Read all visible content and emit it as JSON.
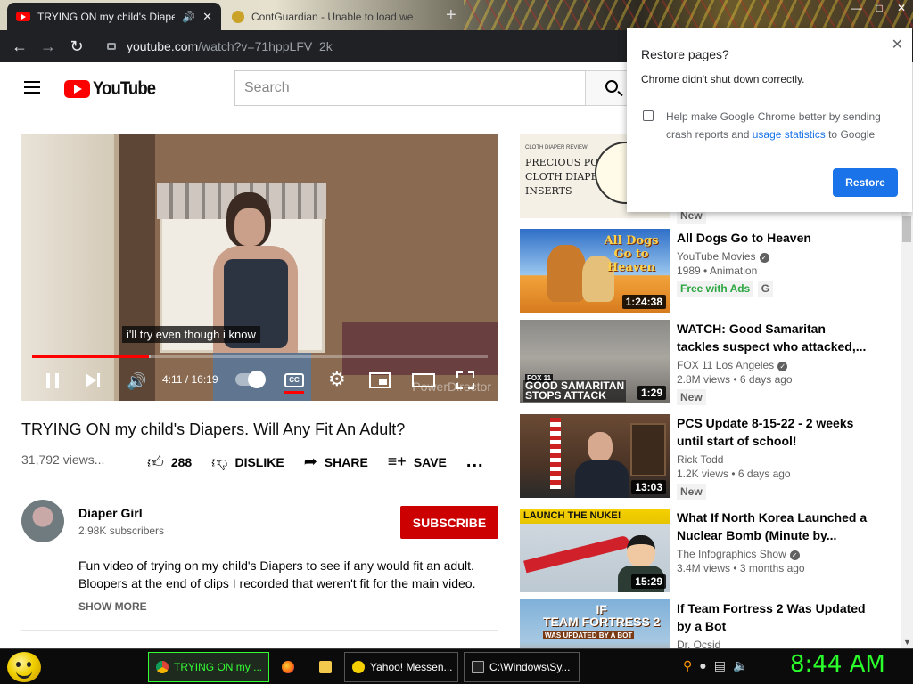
{
  "browser": {
    "tabs": [
      {
        "title": "TRYING ON my child's Diape",
        "active": true
      },
      {
        "title": "ContGuardian - Unable to load we",
        "active": false
      }
    ],
    "address": {
      "host": "youtube.com",
      "path": "/watch?v=71hppLFV_2k"
    }
  },
  "youtube": {
    "logo_text": "YouTube",
    "search_placeholder": "Search"
  },
  "player": {
    "caption": "i'll try even though i know",
    "watermark": "PowerDirector",
    "time": "4:11 / 16:19",
    "progress_played_fraction": 0.257,
    "progress_buffered_fraction": 0.26
  },
  "video": {
    "title": "TRYING ON my child's Diapers. Will Any Fit An Adult?",
    "views": "31,792 views...",
    "like_count": "288",
    "dislike_label": "DISLIKE",
    "share_label": "SHARE",
    "save_label": "SAVE",
    "more_label": "..."
  },
  "channel": {
    "name": "Diaper Girl",
    "subscribers": "2.98K subscribers",
    "subscribe_label": "SUBSCRIBE",
    "description_line1": "Fun video of trying on my child's Diapers to see if any would fit an adult.",
    "description_line2": "Bloopers at the end of clips I recorded that weren't fit for the main video.",
    "show_more": "SHOW MORE"
  },
  "recommendations": [
    {
      "thumb_lines": [
        "PRECIOUS POMPIS",
        "CLOTH DIAPER",
        "INSERTS"
      ],
      "thumb_small": "CLOTH DIAPER REVIEW:",
      "badge": "New"
    },
    {
      "title": "All Dogs Go to Heaven",
      "channel": "YouTube Movies",
      "line2": "1989 • Animation",
      "badge1": "Free with Ads",
      "badge2": "G",
      "duration": "1:24:38",
      "thumb_text": "All Dogs Go to Heaven"
    },
    {
      "title_line1": "WATCH: Good Samaritan",
      "title_line2": "tackles suspect who attacked,...",
      "channel": "FOX 11 Los Angeles",
      "line2": "2.8M views • 6 days ago",
      "badge": "New",
      "duration": "1:29",
      "thumb_caption_1": "GOOD SAMARITAN",
      "thumb_caption_2": "STOPS ATTACK",
      "thumb_logo": "FOX 11"
    },
    {
      "title_line1": "PCS Update 8-15-22 - 2 weeks",
      "title_line2": "until start of school!",
      "channel": "Rick Todd",
      "line2": "1.2K views • 6 days ago",
      "badge": "New",
      "duration": "13:03"
    },
    {
      "title_line1": "What If North Korea Launched a",
      "title_line2": "Nuclear Bomb (Minute by...",
      "channel": "The Infographics Show",
      "line2": "3.4M views • 3 months ago",
      "duration": "15:29",
      "thumb_text": "LAUNCH THE NUKE!"
    },
    {
      "title_line1": "If Team Fortress 2 Was Updated",
      "title_line2": "by a Bot",
      "channel": "Dr. Ocsid",
      "thumb_line1": "IF",
      "thumb_line2": "TEAM FORTRESS 2",
      "thumb_line3": "WAS UPDATED BY A BOT"
    }
  ],
  "popup": {
    "title": "Restore pages?",
    "message": "Chrome didn't shut down correctly.",
    "checkbox_text_1": "Help make Google Chrome better by sending crash reports and ",
    "checkbox_link": "usage statistics",
    "checkbox_text_2": " to Google",
    "button": "Restore"
  },
  "taskbar": {
    "items": [
      {
        "label": "TRYING ON my ..."
      },
      {
        "label": "Yahoo! Messen..."
      },
      {
        "label": "C:\\Windows\\Sy..."
      }
    ],
    "clock": "8:44 AM"
  },
  "colors": {
    "youtube_red": "#ff0000",
    "subscribe_red": "#cc0000",
    "chrome_blue": "#1a73e8",
    "clock_green": "#2bff2b"
  }
}
